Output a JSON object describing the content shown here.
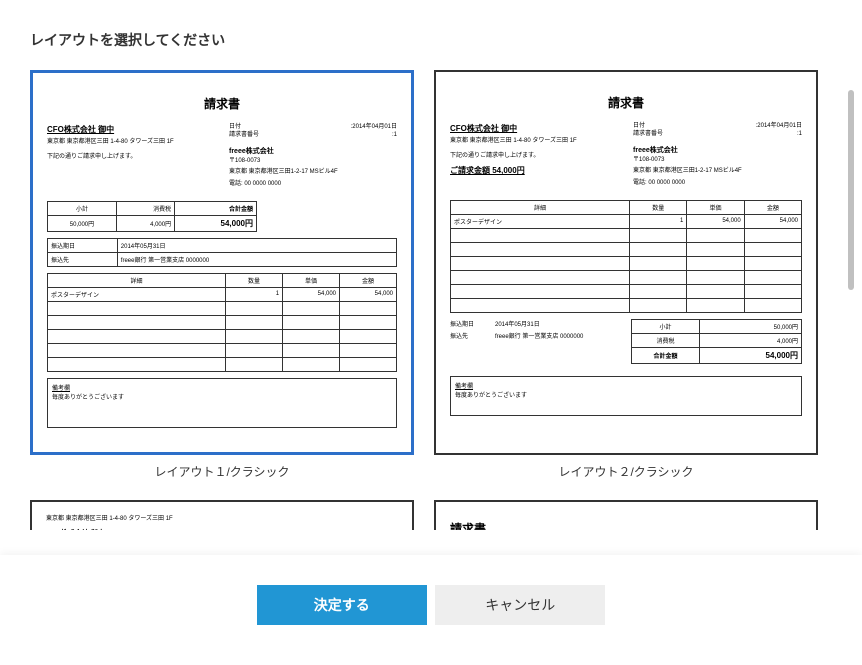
{
  "header": {
    "title": "レイアウトを選択してください"
  },
  "layouts": [
    {
      "label": "レイアウト１/クラシック",
      "doc_title": "請求書",
      "client": "CFO株式会社 御中",
      "client_addr": "東京都 東京都港区三田 1-4-80\nタワーズ三田 1F",
      "message": "下記の通りご請求申し上げます。",
      "date_label": "日付",
      "date_value": "2014年04月01日",
      "ref_label": "請求書番号",
      "ref_value": "1",
      "company": "freee株式会社",
      "company_postal": "〒108-0073",
      "company_addr": "東京都 東京都港区三田1-2-17\nMSビル4F",
      "tel": "電話: 00 0000 0000",
      "summary": {
        "subtotal_label": "小計",
        "subtotal": "50,000円",
        "tax_label": "消費税",
        "tax": "4,000円",
        "total_label": "合計金額",
        "total": "54,000円"
      },
      "bank": {
        "due_label": "振込期日",
        "due": "2014年05月31日",
        "acct_label": "振込先",
        "acct": "freee銀行 第一営業支店 0000000"
      },
      "detail_headers": [
        "詳細",
        "数量",
        "単価",
        "金額"
      ],
      "items": [
        {
          "name": "ポスターデザイン",
          "qty": "1",
          "unit": "54,000",
          "amount": "54,000"
        }
      ],
      "note_label": "備考欄",
      "note": "毎度ありがとうございます"
    },
    {
      "label": "レイアウト２/クラシック",
      "doc_title": "請求書",
      "client": "CFO株式会社 御中",
      "client_addr": "東京都 東京都港区三田 1-4-80\nタワーズ三田 1F",
      "message": "下記の通りご請求申し上げます。",
      "total_line": "ご請求金額 54,000円",
      "date_label": "日付",
      "date_value": "2014年04月01日",
      "ref_label": "請求書番号",
      "ref_value": "1",
      "company": "freee株式会社",
      "company_postal": "〒108-0073",
      "company_addr": "東京都 東京都港区三田1-2-17\nMSビル4F",
      "tel": "電話: 00 0000 0000",
      "detail_headers": [
        "詳細",
        "数量",
        "単価",
        "金額"
      ],
      "items": [
        {
          "name": "ポスターデザイン",
          "qty": "1",
          "unit": "54,000",
          "amount": "54,000"
        }
      ],
      "bank": {
        "due_label": "振込期日",
        "due": "2014年05月31日",
        "acct_label": "振込先",
        "acct": "freee銀行 第一営業支店 0000000"
      },
      "summary": {
        "subtotal_label": "小計",
        "subtotal": "50,000円",
        "tax_label": "消費税",
        "tax": "4,000円",
        "total_label": "合計金額",
        "total": "54,000円"
      },
      "note_label": "備考欄",
      "note": "毎度ありがとうございます"
    }
  ],
  "partial": {
    "client_addr": "東京都 東京都港区三田 1-4-80\nタワーズ三田 1F",
    "client": "CFO株式会社 御中",
    "doc_title": "請求書"
  },
  "footer": {
    "submit": "決定する",
    "cancel": "キャンセル"
  }
}
